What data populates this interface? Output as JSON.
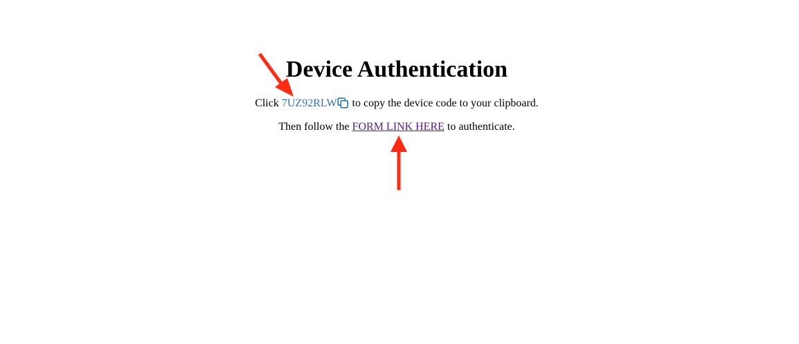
{
  "heading": "Device Authentication",
  "instructions": {
    "line1_prefix": "Click ",
    "device_code": "7UZ92RLW",
    "line1_suffix": " to copy the device code to your clipboard.",
    "line2_prefix": "Then follow the ",
    "form_link_label": "FORM LINK HERE",
    "line2_suffix": " to authenticate."
  },
  "icons": {
    "copy": "copy-icon",
    "annotation_arrows": [
      "arrow-icon",
      "arrow-icon"
    ]
  },
  "colors": {
    "code_link": "#2b74c2",
    "visited_link": "#551a8b",
    "annotation_arrow": "#ff2a12"
  }
}
